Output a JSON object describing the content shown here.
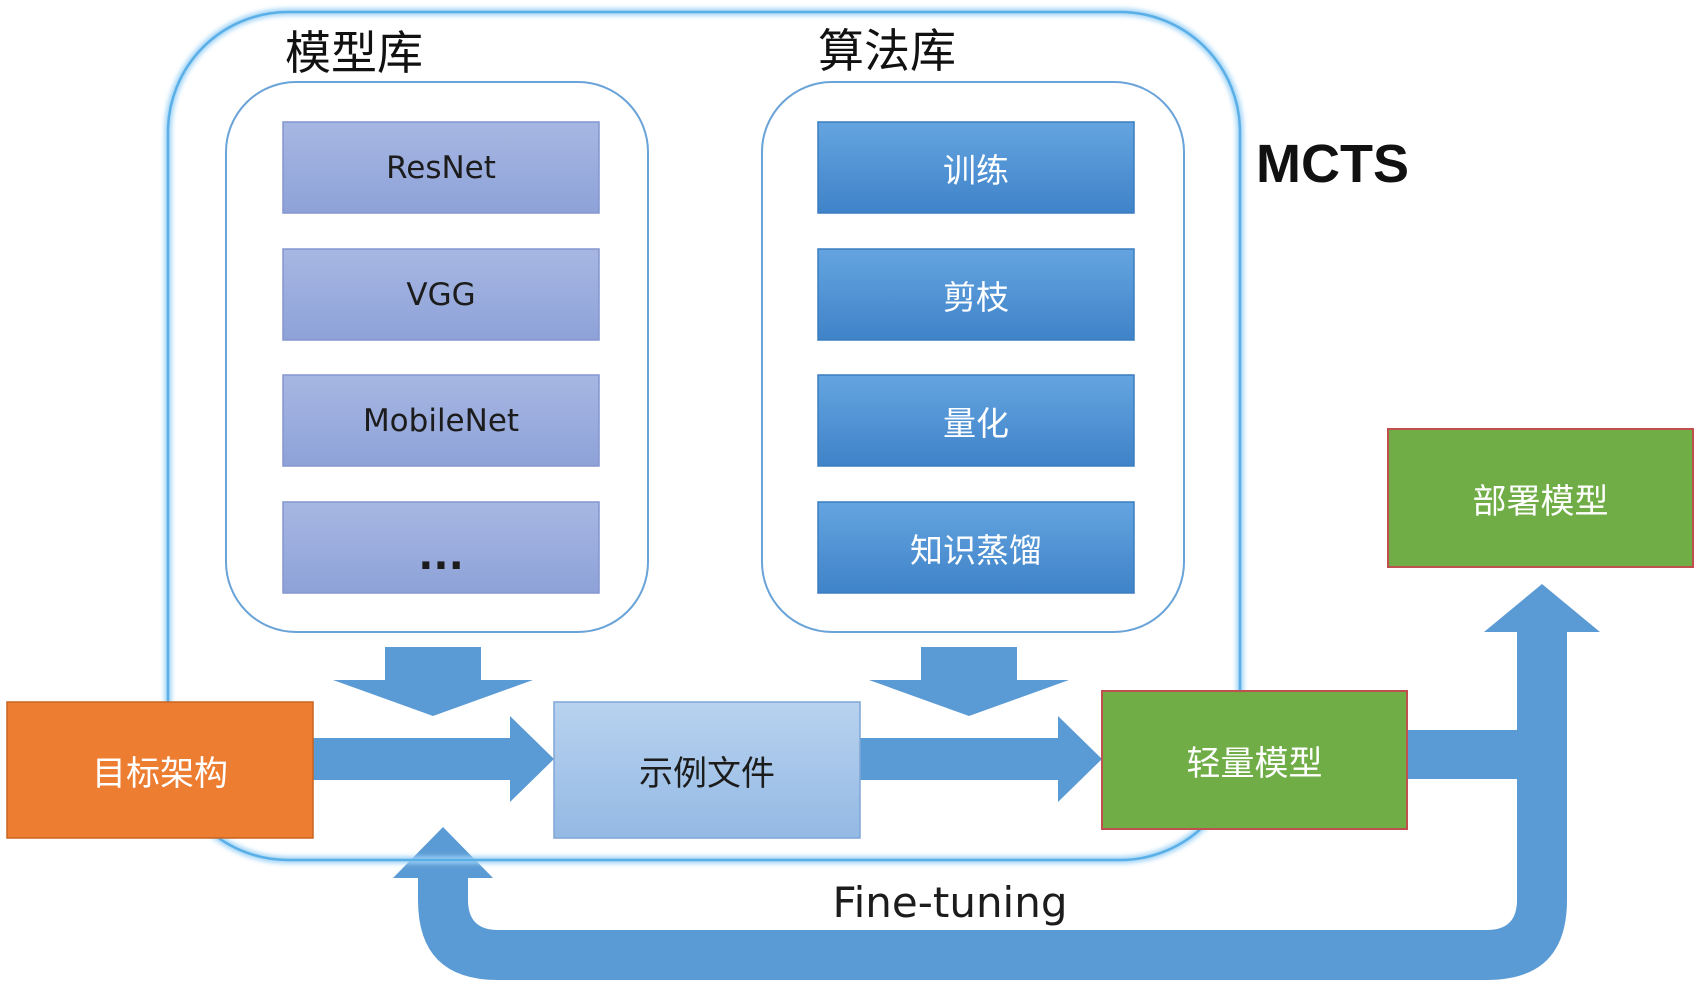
{
  "mcts": {
    "label": "MCTS"
  },
  "model_library": {
    "title": "模型库",
    "items": [
      "ResNet",
      "VGG",
      "MobileNet",
      "..."
    ]
  },
  "algorithm_library": {
    "title": "算法库",
    "items": [
      "训练",
      "剪枝",
      "量化",
      "知识蒸馏"
    ]
  },
  "flow": {
    "target": "目标架构",
    "example": "示例文件",
    "lightweight": "轻量模型",
    "deploy": "部署模型"
  },
  "feedback": {
    "label": "Fine-tuning"
  },
  "colors": {
    "outer_border": "#5aafe6",
    "inner_border": "#6aa3d8",
    "model_item_fill": "#95a9dc",
    "model_item_border": "#7f93cc",
    "algo_item_fill": "#4f92d2",
    "algo_item_border": "#3f7fc0",
    "arrow_fill": "#5b9bd5",
    "target_fill": "#ed7d31",
    "example_fill": "#a5c4e8",
    "green_fill": "#70ad47",
    "green_border": "#c0504d"
  }
}
